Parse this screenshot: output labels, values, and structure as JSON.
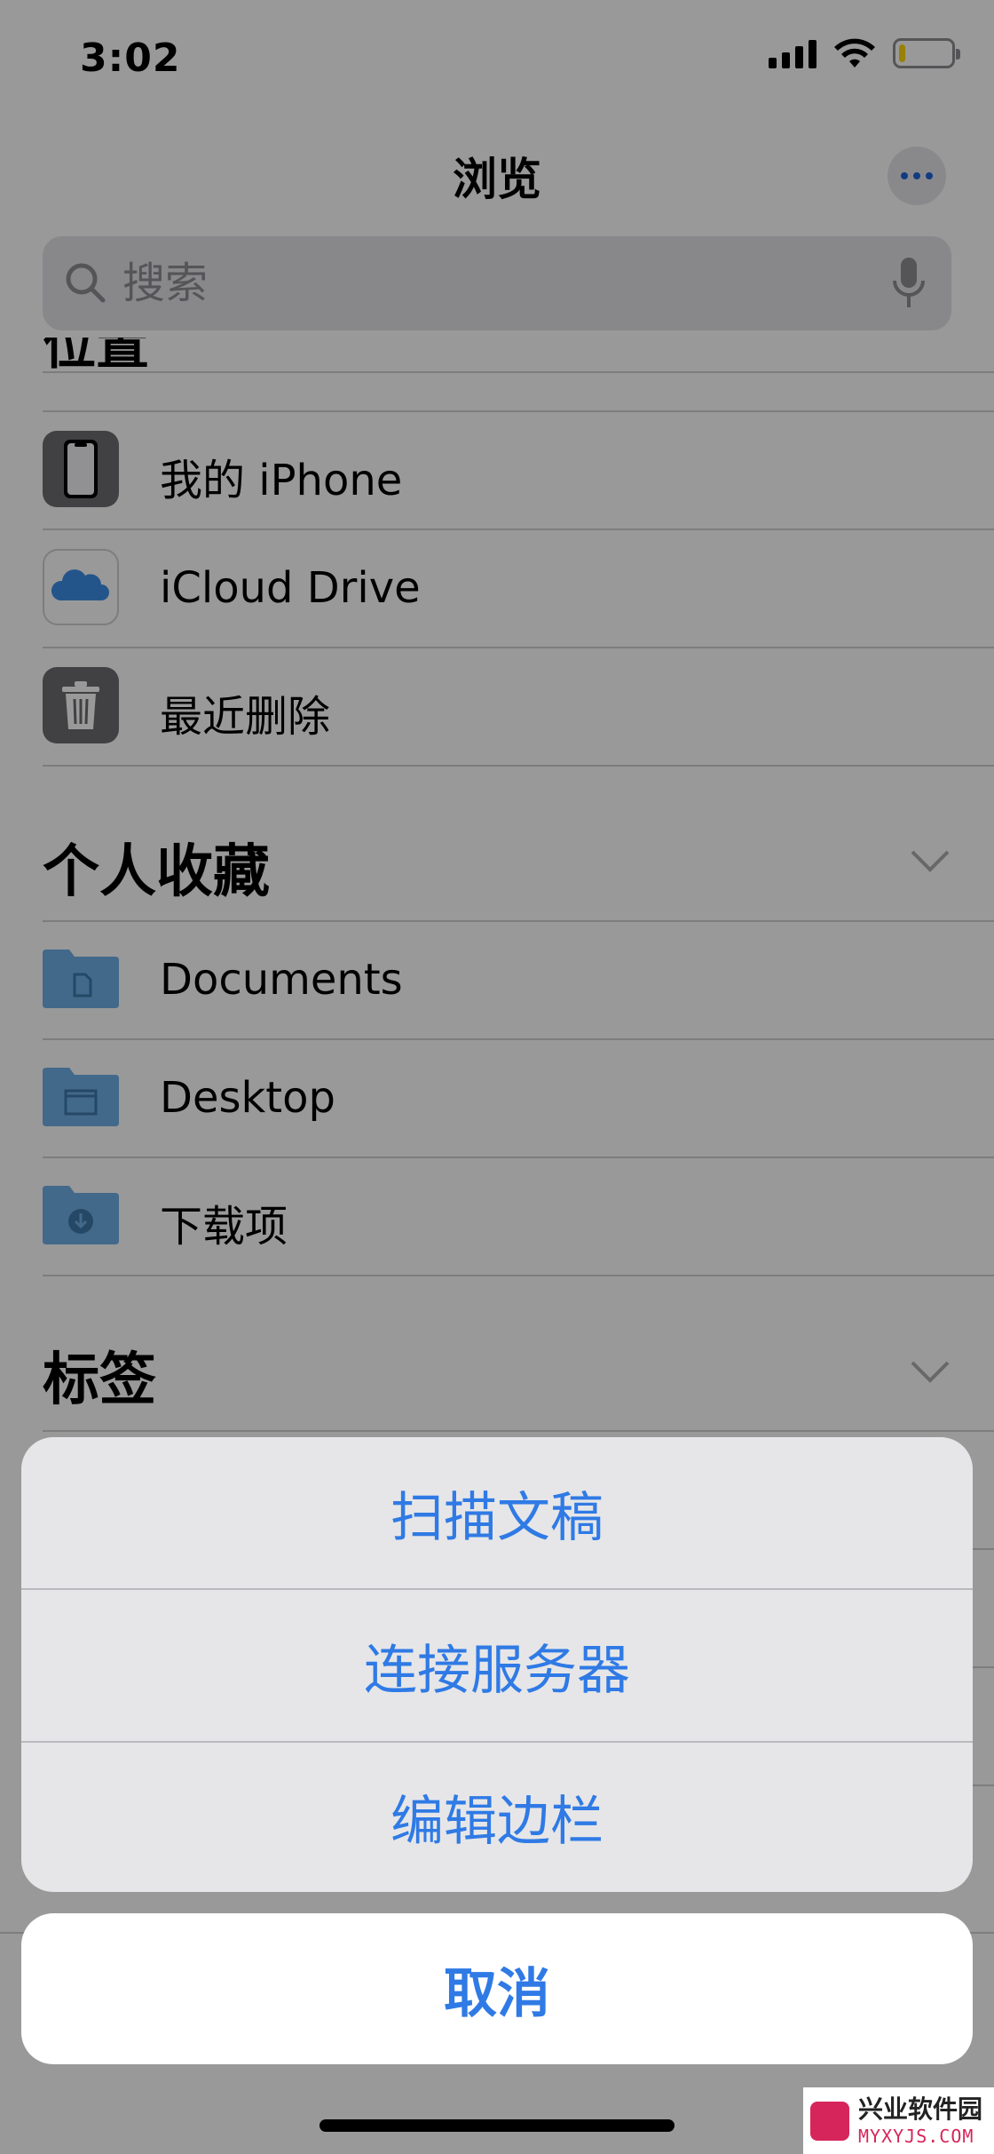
{
  "status_bar": {
    "time": "3:02",
    "battery_level": 0.12
  },
  "nav": {
    "title": "浏览"
  },
  "search": {
    "placeholder": "搜索"
  },
  "locations": {
    "items": [
      {
        "label": "我的 iPhone",
        "icon": "iphone-icon"
      },
      {
        "label": "iCloud Drive",
        "icon": "icloud-icon"
      },
      {
        "label": "最近删除",
        "icon": "trash-icon"
      }
    ]
  },
  "favorites": {
    "title": "个人收藏",
    "items": [
      {
        "label": "Documents",
        "icon": "folder-documents-icon"
      },
      {
        "label": "Desktop",
        "icon": "folder-desktop-icon"
      },
      {
        "label": "下载项",
        "icon": "folder-downloads-icon"
      }
    ]
  },
  "tags": {
    "title": "标签"
  },
  "action_sheet": {
    "actions": [
      {
        "label": "扫描文稿"
      },
      {
        "label": "连接服务器"
      },
      {
        "label": "编辑边栏"
      }
    ],
    "cancel": "取消"
  },
  "colors": {
    "accent": "#2f7ae5",
    "folder": "#6fb0e6"
  },
  "watermark": {
    "name": "兴业软件园",
    "domain": "MYXYJS.COM"
  }
}
